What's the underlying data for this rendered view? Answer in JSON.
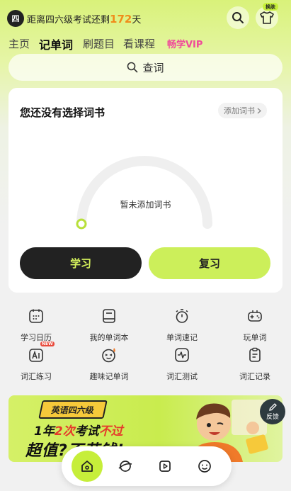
{
  "header": {
    "badge": "四",
    "countdown_prefix": "距离四六级考试还剩",
    "countdown_days": "172",
    "countdown_suffix": "天",
    "skin_tag": "换肤"
  },
  "tabs": [
    {
      "label": "主页",
      "active": false
    },
    {
      "label": "记单词",
      "active": true
    },
    {
      "label": "刷题目",
      "active": false
    },
    {
      "label": "看课程",
      "active": false
    },
    {
      "label": "畅学VIP",
      "active": false
    }
  ],
  "search": {
    "placeholder": "查词"
  },
  "card": {
    "title": "您还没有选择词书",
    "add_book": "添加词书",
    "empty_text": "暂未添加词书",
    "progress": 0,
    "learn_button": "学习",
    "review_button": "复习"
  },
  "grid": [
    {
      "label": "学习日历",
      "icon": "calendar-icon"
    },
    {
      "label": "我的单词本",
      "icon": "wordbook-icon"
    },
    {
      "label": "单词速记",
      "icon": "stopwatch-icon"
    },
    {
      "label": "玩单词",
      "icon": "gamepad-icon"
    },
    {
      "label": "词汇练习",
      "icon": "ai-practice-icon",
      "tag": "NEW"
    },
    {
      "label": "趣味记单词",
      "icon": "fun-face-icon"
    },
    {
      "label": "词汇测试",
      "icon": "test-pulse-icon"
    },
    {
      "label": "词汇记录",
      "icon": "clipboard-icon"
    }
  ],
  "banner": {
    "tag": "英语四六级",
    "line1_a": "1年",
    "line1_b": "2次",
    "line1_c": "考试",
    "line1_d": "不过",
    "line2": "超值?不花钱!"
  },
  "feedback": {
    "label": "反馈"
  },
  "bottom_nav": [
    {
      "icon": "home-icon",
      "active": true
    },
    {
      "icon": "planet-icon",
      "active": false
    },
    {
      "icon": "video-icon",
      "active": false
    },
    {
      "icon": "smile-icon",
      "active": false
    }
  ],
  "colors": {
    "accent_lime": "#c6ee3a",
    "dark": "#222222",
    "countdown_orange": "#f08c1a",
    "vip_pink": "#f04a9a"
  }
}
